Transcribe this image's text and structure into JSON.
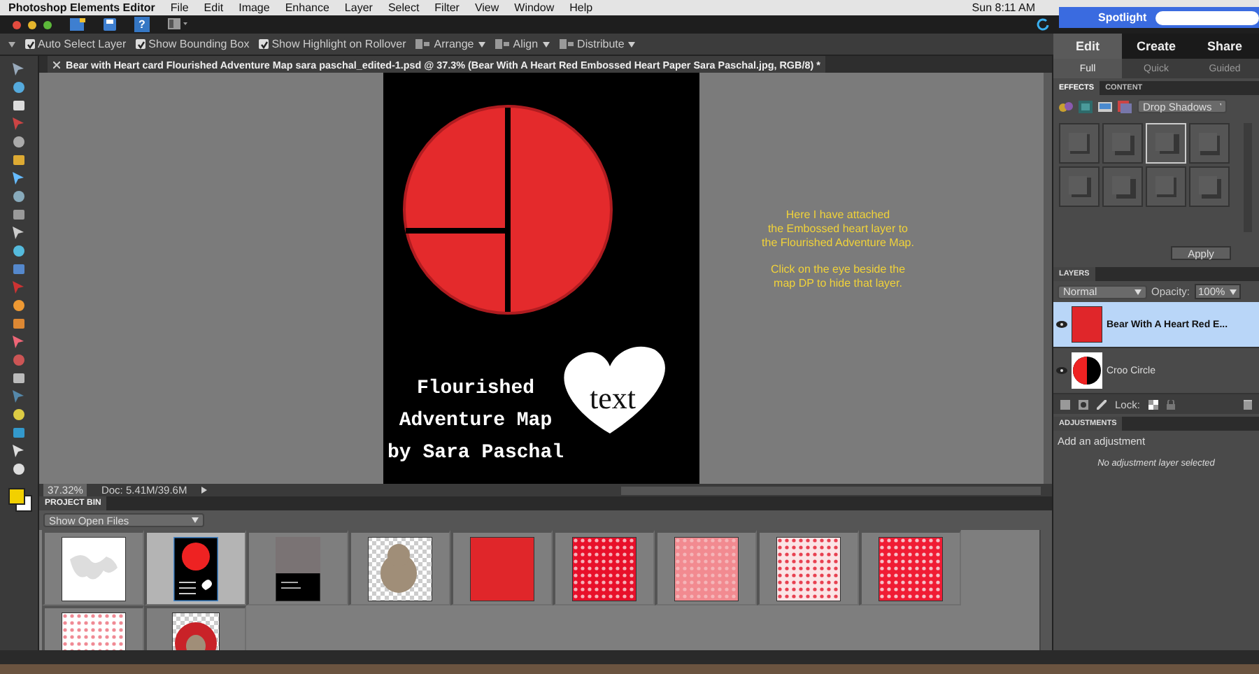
{
  "menubar": {
    "app": "Photoshop Elements Editor",
    "menus": [
      "File",
      "Edit",
      "Image",
      "Enhance",
      "Layer",
      "Select",
      "Filter",
      "View",
      "Window",
      "Help"
    ],
    "clock": "Sun 8:11 AM"
  },
  "titlebar": {
    "help_button": "?"
  },
  "spotlight": {
    "label": "Spotlight"
  },
  "options": [
    {
      "label": "Auto Select Layer",
      "checked": true
    },
    {
      "label": "Show Bounding Box",
      "checked": true
    },
    {
      "label": "Show Highlight on Rollover",
      "checked": true
    }
  ],
  "option_menus": [
    "Arrange",
    "Align",
    "Distribute"
  ],
  "document_tab": {
    "title": "Bear with Heart card Flourished Adventure Map sara paschal_edited-1.psd @ 37.3% (Bear With A Heart Red Embossed Heart Paper Sara Paschal.jpg, RGB/8) *"
  },
  "canvas": {
    "title_lines": [
      "Flourished",
      "Adventure Map",
      "by Sara Paschal"
    ],
    "heart_text": "text",
    "note_paragraphs": [
      [
        "Here I have attached",
        "the Embossed heart layer to",
        "the Flourished Adventure Map."
      ],
      [
        "Click on the eye beside the",
        "map DP to hide that layer."
      ]
    ]
  },
  "status": {
    "zoom": "37.32%",
    "doc": "Doc: 5.41M/39.6M"
  },
  "project_bin": {
    "title": "PROJECT BIN",
    "filter": "Show Open Files",
    "files": [
      {
        "kind": "map",
        "selected": false
      },
      {
        "kind": "card",
        "selected": true
      },
      {
        "kind": "card-blank",
        "selected": false
      },
      {
        "kind": "bear",
        "selected": false
      },
      {
        "kind": "red",
        "selected": false
      },
      {
        "kind": "red-pattern",
        "selected": false
      },
      {
        "kind": "pink",
        "selected": false
      },
      {
        "kind": "white-dots",
        "selected": false
      },
      {
        "kind": "red-dots",
        "selected": false
      },
      {
        "kind": "pink-checks",
        "selected": false
      },
      {
        "kind": "bear-circle",
        "selected": false
      }
    ]
  },
  "mode_tabs": [
    {
      "label": "Edit",
      "selected": true
    },
    {
      "label": "Create",
      "selected": false
    },
    {
      "label": "Share",
      "selected": false
    }
  ],
  "edit_modes": [
    {
      "label": "Full",
      "selected": true
    },
    {
      "label": "Quick",
      "selected": false
    },
    {
      "label": "Guided",
      "selected": false
    }
  ],
  "effects": {
    "tabs": [
      {
        "label": "EFFECTS",
        "selected": true
      },
      {
        "label": "CONTENT",
        "selected": false
      }
    ],
    "category": "Drop Shadows",
    "presets": [
      {
        "selected": false
      },
      {
        "selected": false
      },
      {
        "selected": true
      },
      {
        "selected": false
      },
      {
        "selected": false
      },
      {
        "selected": false
      },
      {
        "selected": false
      },
      {
        "selected": false
      }
    ],
    "apply": "Apply"
  },
  "layers": {
    "title": "LAYERS",
    "blend": "Normal",
    "opacity_label": "Opacity:",
    "opacity": "100%",
    "items": [
      {
        "name": "Bear With A Heart Red E...",
        "kind": "red",
        "selected": true,
        "visible": true
      },
      {
        "name": "Croo Circle",
        "kind": "circle",
        "selected": false,
        "visible": true
      }
    ],
    "lock_label": "Lock:"
  },
  "adjustments": {
    "title": "ADJUSTMENTS",
    "prompt": "Add an adjustment",
    "empty": "No adjustment layer selected"
  }
}
